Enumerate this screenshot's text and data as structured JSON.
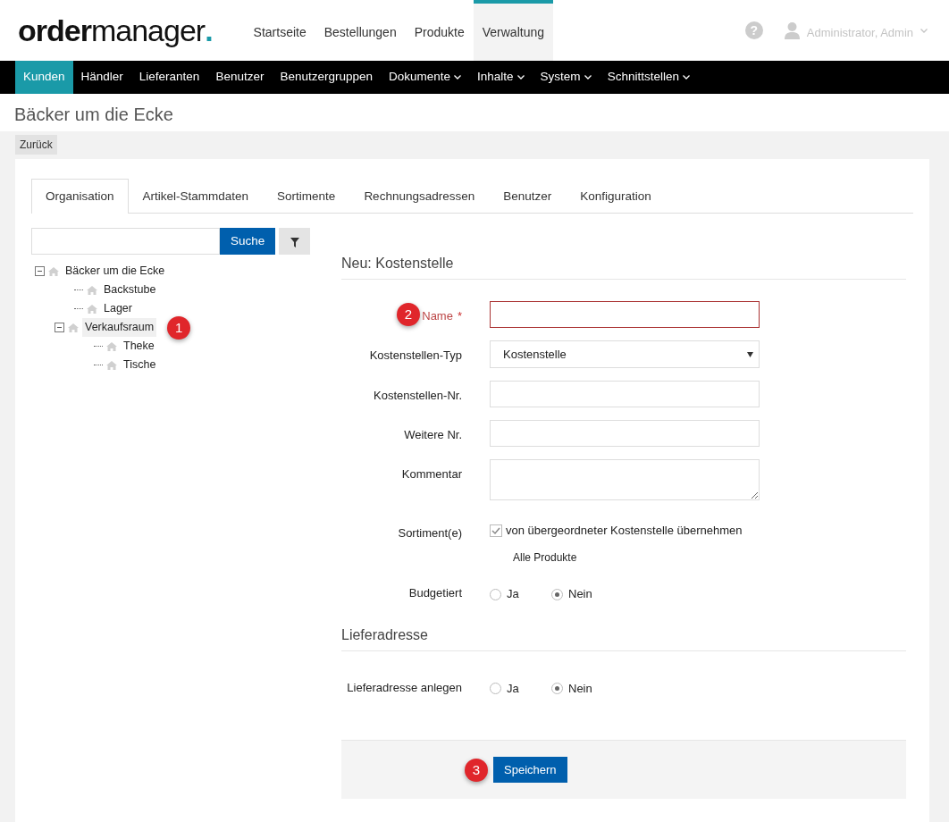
{
  "logo": {
    "bold": "order",
    "light": "manager",
    "dot": "."
  },
  "top_nav": [
    {
      "label": "Startseite",
      "selected": false
    },
    {
      "label": "Bestellungen",
      "selected": false
    },
    {
      "label": "Produkte",
      "selected": false
    },
    {
      "label": "Verwaltung",
      "selected": true
    }
  ],
  "help": {
    "glyph": "?"
  },
  "user_menu": {
    "label": "Administrator, Admin"
  },
  "sub_nav": [
    {
      "label": "Kunden",
      "selected": true,
      "dropdown": false
    },
    {
      "label": "Händler",
      "selected": false,
      "dropdown": false
    },
    {
      "label": "Lieferanten",
      "selected": false,
      "dropdown": false
    },
    {
      "label": "Benutzer",
      "selected": false,
      "dropdown": false
    },
    {
      "label": "Benutzergruppen",
      "selected": false,
      "dropdown": false
    },
    {
      "label": "Dokumente",
      "selected": false,
      "dropdown": true
    },
    {
      "label": "Inhalte",
      "selected": false,
      "dropdown": true
    },
    {
      "label": "System",
      "selected": false,
      "dropdown": true
    },
    {
      "label": "Schnittstellen",
      "selected": false,
      "dropdown": true
    }
  ],
  "page_title": "Bäcker um die Ecke",
  "back_button": "Zurück",
  "tabs": [
    {
      "label": "Organisation",
      "selected": true
    },
    {
      "label": "Artikel-Stammdaten",
      "selected": false
    },
    {
      "label": "Sortimente",
      "selected": false
    },
    {
      "label": "Rechnungsadressen",
      "selected": false
    },
    {
      "label": "Benutzer",
      "selected": false
    },
    {
      "label": "Konfiguration",
      "selected": false
    }
  ],
  "search": {
    "button": "Suche"
  },
  "tree": [
    {
      "label": "Bäcker um die Ecke",
      "expanded": true,
      "selected": false,
      "children": [
        {
          "label": "Backstube",
          "selected": false
        },
        {
          "label": "Lager",
          "selected": false
        },
        {
          "label": "Verkaufsraum",
          "expanded": true,
          "selected": true,
          "marker": "1",
          "children": [
            {
              "label": "Theke",
              "selected": false
            },
            {
              "label": "Tische",
              "selected": false
            }
          ]
        }
      ]
    }
  ],
  "form": {
    "title": "Neu: Kostenstelle",
    "fields": [
      {
        "kind": "text",
        "label": "Name",
        "required_mark": "*",
        "invalid": true,
        "marker": "2"
      },
      {
        "kind": "select",
        "label": "Kostenstellen-Typ",
        "value": "Kostenstelle"
      },
      {
        "kind": "text",
        "label": "Kostenstellen-Nr.",
        "invalid": false
      },
      {
        "kind": "text",
        "label": "Weitere Nr.",
        "invalid": false
      },
      {
        "kind": "textarea",
        "label": "Kommentar"
      },
      {
        "kind": "checkbox",
        "label": "Sortiment(e)",
        "option": "von übergeordneter Kostenstelle übernehmen",
        "checked": true,
        "note": "Alle Produkte"
      },
      {
        "kind": "radio",
        "label": "Budgetiert",
        "options": [
          {
            "label": "Ja",
            "selected": false
          },
          {
            "label": "Nein",
            "selected": true
          }
        ]
      }
    ]
  },
  "delivery": {
    "title": "Lieferadresse",
    "fields": [
      {
        "kind": "radio",
        "label": "Lieferadresse anlegen",
        "options": [
          {
            "label": "Ja",
            "selected": false
          },
          {
            "label": "Nein",
            "selected": true
          }
        ]
      }
    ]
  },
  "save": {
    "label": "Speichern",
    "marker": "3"
  }
}
